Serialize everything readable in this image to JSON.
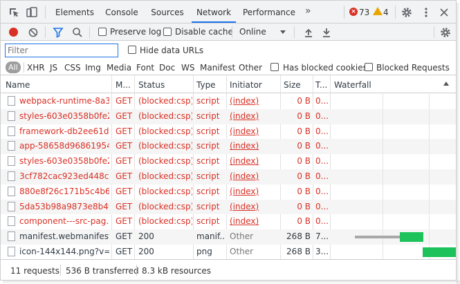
{
  "tabs": [
    "Elements",
    "Console",
    "Sources",
    "Network",
    "Performance"
  ],
  "more_tabs": "»",
  "errors": "73",
  "warnings": "4",
  "toolbar": {
    "preserve_log": "Preserve log",
    "disable_cache": "Disable cache",
    "throttling": "Online"
  },
  "filter": {
    "placeholder": "Filter",
    "hide_data_urls": "Hide data URLs"
  },
  "types": {
    "all": "All",
    "items": [
      "XHR",
      "JS",
      "CSS",
      "Img",
      "Media",
      "Font",
      "Doc",
      "WS",
      "Manifest",
      "Other"
    ],
    "has_blocked_cookies": "Has blocked cookies",
    "blocked_requests": "Blocked Requests"
  },
  "columns": [
    "Name",
    "M...",
    "Status",
    "Type",
    "Initiator",
    "Size",
    "T...",
    "Waterfall"
  ],
  "rows": [
    {
      "name": "webpack-runtime-8a3...",
      "method": "GET",
      "status": "(blocked:csp)",
      "type": "script",
      "initiator": "(index)",
      "size": "0 B",
      "time": "0...",
      "blocked": true
    },
    {
      "name": "styles-603e0358b0fe2...",
      "method": "GET",
      "status": "(blocked:csp)",
      "type": "script",
      "initiator": "(index)",
      "size": "0 B",
      "time": "0...",
      "blocked": true
    },
    {
      "name": "framework-db2ee61d8...",
      "method": "GET",
      "status": "(blocked:csp)",
      "type": "script",
      "initiator": "(index)",
      "size": "0 B",
      "time": "0...",
      "blocked": true
    },
    {
      "name": "app-58658d96861954...",
      "method": "GET",
      "status": "(blocked:csp)",
      "type": "script",
      "initiator": "(index)",
      "size": "0 B",
      "time": "0...",
      "blocked": true
    },
    {
      "name": "styles-603e0358b0fe2...",
      "method": "GET",
      "status": "(blocked:csp)",
      "type": "script",
      "initiator": "(index)",
      "size": "0 B",
      "time": "0...",
      "blocked": true
    },
    {
      "name": "3cf782cac923ed448c3...",
      "method": "GET",
      "status": "(blocked:csp)",
      "type": "script",
      "initiator": "(index)",
      "size": "0 B",
      "time": "0...",
      "blocked": true
    },
    {
      "name": "880e8f26c171b5c4b6e...",
      "method": "GET",
      "status": "(blocked:csp)",
      "type": "script",
      "initiator": "(index)",
      "size": "0 B",
      "time": "0...",
      "blocked": true
    },
    {
      "name": "5da53b98a9873e8b49...",
      "method": "GET",
      "status": "(blocked:csp)",
      "type": "script",
      "initiator": "(index)",
      "size": "0 B",
      "time": "0...",
      "blocked": true
    },
    {
      "name": "component---src-pag...",
      "method": "GET",
      "status": "(blocked:csp)",
      "type": "script",
      "initiator": "(index)",
      "size": "0 B",
      "time": "0...",
      "blocked": true
    },
    {
      "name": "manifest.webmanifest",
      "method": "GET",
      "status": "200",
      "type": "manif...",
      "initiator": "Other",
      "size": "268 B",
      "time": "7...",
      "blocked": false
    },
    {
      "name": "icon-144x144.png?v=9...",
      "method": "GET",
      "status": "200",
      "type": "png",
      "initiator": "Other",
      "size": "268 B",
      "time": "3...",
      "blocked": false
    }
  ],
  "statusbar": {
    "requests": "11 requests",
    "transferred": "536 B transferred",
    "resources": "8.3 kB resources"
  },
  "colors": {
    "error_red": "#d93025",
    "accent_blue": "#1a73e8",
    "waterfall_green": "#1dc25b"
  }
}
